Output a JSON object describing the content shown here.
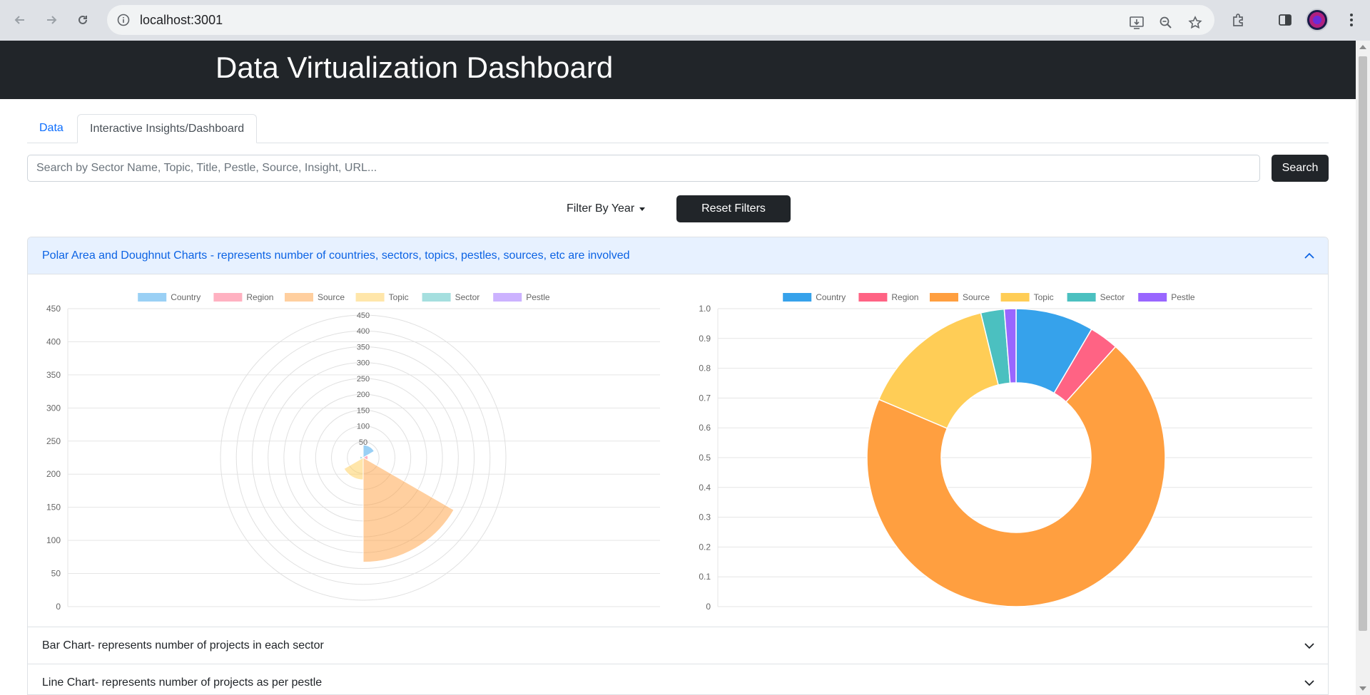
{
  "browser": {
    "url": "localhost:3001"
  },
  "header": {
    "title": "Data Virtualization Dashboard"
  },
  "tabs": [
    {
      "label": "Data"
    },
    {
      "label": "Interactive Insights/Dashboard"
    }
  ],
  "search": {
    "placeholder": "Search by Sector Name, Topic, Title, Pestle, Source, Insight, URL...",
    "button_label": "Search"
  },
  "filters": {
    "year_label": "Filter By Year",
    "reset_label": "Reset Filters"
  },
  "accordion": {
    "open_section": "Polar Area and Doughnut Charts - represents number of countries, sectors, topics, pestles, sources, etc are involved",
    "bar_section": "Bar Chart- represents number of projects in each sector",
    "line_section": "Line Chart- represents number of projects as per pestle"
  },
  "colors": {
    "country": "#36a2eb",
    "region": "#ff6384",
    "source": "#ff9f40",
    "topic": "#ffcd56",
    "sector": "#4bc0c0",
    "pestle": "#9966ff"
  },
  "chart_data": [
    {
      "type": "polarArea",
      "categories": [
        "Country",
        "Region",
        "Source",
        "Topic",
        "Sector",
        "Pestle"
      ],
      "values": [
        40,
        15,
        330,
        70,
        10,
        5
      ],
      "ylim": [
        0,
        450
      ],
      "yticks": [
        0,
        50,
        100,
        150,
        200,
        250,
        300,
        350,
        400,
        450
      ],
      "rticks": [
        50,
        100,
        150,
        200,
        250,
        300,
        350,
        400,
        450
      ],
      "legend": "top"
    },
    {
      "type": "doughnut",
      "categories": [
        "Country",
        "Region",
        "Source",
        "Topic",
        "Sector",
        "Pestle"
      ],
      "values": [
        40,
        15,
        330,
        70,
        12,
        6
      ],
      "ylim": [
        0,
        1.0
      ],
      "yticks": [
        "0",
        "0.1",
        "0.2",
        "0.3",
        "0.4",
        "0.5",
        "0.6",
        "0.7",
        "0.8",
        "0.9",
        "1.0"
      ],
      "legend": "top"
    }
  ]
}
